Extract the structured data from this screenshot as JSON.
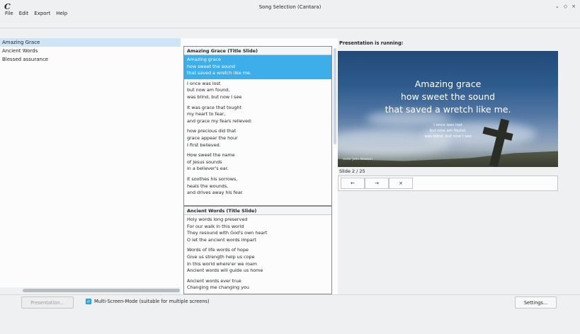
{
  "window": {
    "title": "Song Selection (Cantara)",
    "app_icon": "C",
    "controls": [
      "⌄",
      "◇",
      "×"
    ]
  },
  "menu": [
    "File",
    "Edit",
    "Export",
    "Help"
  ],
  "songs": [
    {
      "name": "Amazing Grace",
      "selected": true
    },
    {
      "name": "Ancient Words",
      "selected": false
    },
    {
      "name": "Blessed assurance",
      "selected": false
    }
  ],
  "song_blocks": [
    {
      "title": "Amazing Grace (Title Slide)",
      "slides": [
        "Amazing grace\nhow sweet the sound\nthat saved a wretch like me.",
        "I once was lost\nbut now am found,\nwas blind, but now I see",
        "It was grace that tought\nmy heart to fear,\nand grace my fears relieved:",
        "how precious did that\ngrace appear the hour\nI first believed.",
        "How sweet the name\nof Jesus sounds\nin a believer's ear.",
        "It soothes his sorrows,\nheals the wounds,\nand drives away his fear."
      ]
    },
    {
      "title": "Ancient Words (Title Slide)",
      "slides": [
        "Holy words long preserved\nFor our walk in this world\nThey resound with God's own heart\nO let the ancient words impart",
        "Words of life words of hope\nGive us strength help us cope\nIn this world where'er we roam\nAncient words will guide us home",
        "Ancient words ever true\nChanging me changing you"
      ]
    }
  ],
  "presentation": {
    "status": "Presentation is running:",
    "preview_title": "Amazing grace\nhow sweet the sound\nthat saved a wretch like me.",
    "preview_next": "I once was lost\nbut now am found,\nwas blind, but now I see",
    "author": "autor John Newton",
    "slide_counter": "Slide 2 / 25",
    "nav": {
      "prev": "←",
      "next": "→",
      "close": "×"
    }
  },
  "bottom": {
    "presentation_button": "Presentation...",
    "multiscreen_label": "Multi-Screen-Mode (suitable for multiple screens)",
    "multiscreen_checked": true,
    "settings_button": "Settings..."
  },
  "colors": {
    "accent": "#3daee9",
    "selection_light": "#cfe5f6"
  }
}
